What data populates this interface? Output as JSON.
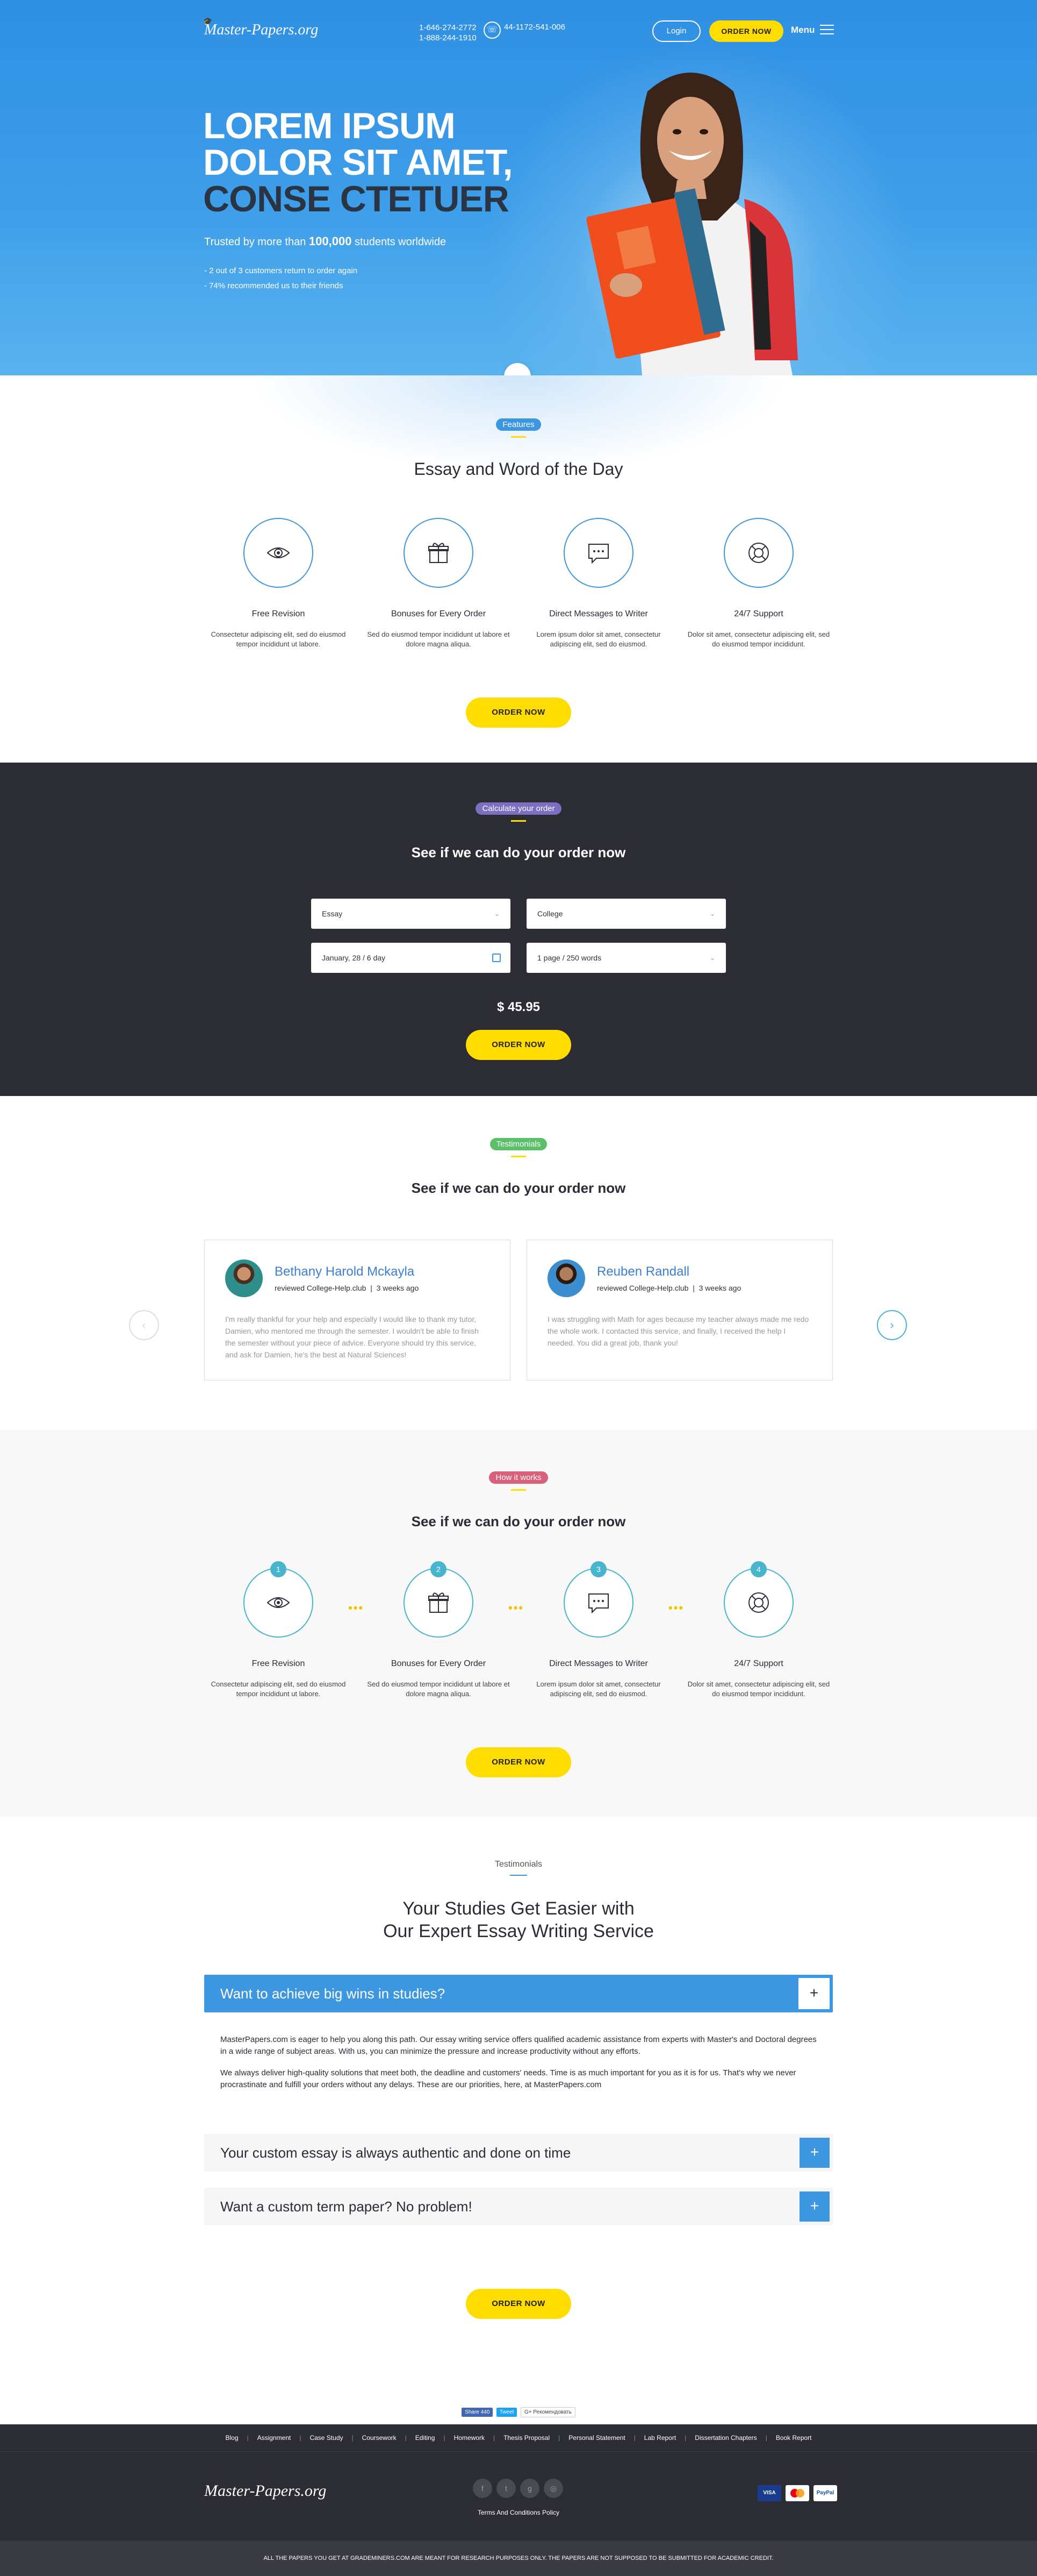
{
  "header": {
    "logo": "Master-Papers.org",
    "phone_us": "1-646-274-2772",
    "phone_us2": "1-888-244-1910",
    "phone_uk": "44-1172-541-006",
    "login": "Login",
    "order_now": "ORDER NOW",
    "menu": "Menu"
  },
  "hero": {
    "line1": "LOREM IPSUM",
    "line2": "DOLOR SIT AMET,",
    "line3": "CONSE CTETUER",
    "trust_pre": "Trusted by more than",
    "trust_num": "100,000",
    "trust_post": "students worldwide",
    "bullet1": "- 2 out of 3 customers return to order again",
    "bullet2": "- 74% recommended us to their friends"
  },
  "features": {
    "pill": "Features",
    "title": "Essay and Word of the Day",
    "items": [
      {
        "title": "Free Revision",
        "text": "Consectetur adipiscing elit, sed do eiusmod tempor incididunt ut labore.",
        "icon": "eye-icon"
      },
      {
        "title": "Bonuses for Every Order",
        "text": "Sed do eiusmod tempor incididunt ut labore et dolore magna aliqua.",
        "icon": "gift-icon"
      },
      {
        "title": "Direct Messages to Writer",
        "text": "Lorem ipsum dolor sit amet, consectetur adipiscing elit, sed do eiusmod.",
        "icon": "message-icon"
      },
      {
        "title": "24/7 Support",
        "text": "Dolor sit amet, consectetur adipiscing elit, sed do eiusmod tempor incididunt.",
        "icon": "lifebuoy-icon"
      }
    ],
    "button": "ORDER NOW"
  },
  "calculator": {
    "pill": "Calculate your order",
    "title": "See if we can do your order now",
    "type": "Essay",
    "level": "College",
    "deadline": "January, 28 / 6 day",
    "pages": "1 page / 250 words",
    "price": "$ 45.95",
    "button": "ORDER NOW"
  },
  "testimonials": {
    "pill": "Testimonials",
    "title": "See if we can do your order now",
    "reviews": [
      {
        "name": "Bethany Harold Mckayla",
        "source": "reviewed College-Help.club",
        "time": "3 weeks ago",
        "text": "I'm really thankful for your help and especially I would like to thank my tutor, Damien, who mentored me through the semester. I wouldn't be able to finish the semester without your piece of advice. Everyone should try this service, and ask for Damien, he's the best at Natural Sciences!"
      },
      {
        "name": "Reuben Randall",
        "source": "reviewed College-Help.club",
        "time": "3 weeks ago",
        "text": "I was struggling with Math for ages because my teacher always made me redo the whole work. I contacted this service, and finally, I received the help I needed. You did a great job, thank you!"
      }
    ]
  },
  "how": {
    "pill": "How it works",
    "title": "See if we can do your order now",
    "steps": [
      {
        "num": "1",
        "title": "Free Revision",
        "text": "Consectetur adipiscing elit, sed do eiusmod tempor incididunt ut labore."
      },
      {
        "num": "2",
        "title": "Bonuses for Every Order",
        "text": "Sed do eiusmod tempor incididunt ut labore et dolore magna aliqua."
      },
      {
        "num": "3",
        "title": "Direct Messages to Writer",
        "text": "Lorem ipsum dolor sit amet, consectetur adipiscing elit, sed do eiusmod."
      },
      {
        "num": "4",
        "title": "24/7 Support",
        "text": "Dolor sit amet, consectetur adipiscing elit, sed do eiusmod tempor incididunt."
      }
    ],
    "button": "ORDER NOW"
  },
  "faq": {
    "small": "Testimonials",
    "title1": "Your Studies Get Easier with",
    "title2": "Our Expert Essay Writing Service",
    "open_q": "Want to achieve big wins in studies?",
    "p1": "MasterPapers.com is eager to help you along this path. Our essay writing service offers qualified academic assistance from experts with Master's and Doctoral degrees in a wide range of subject areas. With us, you can minimize the pressure and increase productivity without any efforts.",
    "p2": "We always deliver high-quality solutions that meet both, the deadline and customers' needs. Time is as much important for you as it is for us. That's why we never procrastinate and fulfill your orders without any delays. These are our priorities, here, at MasterPapers.com",
    "q2": "Your custom essay is always authentic and done on time",
    "q3": "Want a custom term paper? No problem!",
    "button": "ORDER NOW"
  },
  "share": {
    "fb": "Share 440",
    "tw": "Tweet",
    "gp": "G+ Рекомендовать"
  },
  "footer": {
    "links": [
      "Blog",
      "Assignment",
      "Case Study",
      "Coursework",
      "Editing",
      "Homework",
      "Thesis Proposal",
      "Personal Statement",
      "Lab Report",
      "Dissertation Chapters",
      "Book Report"
    ],
    "logo": "Master-Papers.org",
    "terms": "Terms And Conditions Policy",
    "pay1": "VISA",
    "pay3": "PayPal",
    "disclaimer": "ALL THE PAPERS YOU GET AT GRADEMINERS.COM ARE MEANT FOR RESEARCH PURPOSES ONLY. THE PAPERS ARE NOT SUPPOSED TO BE SUBMITTED FOR ACADEMIC CREDIT."
  },
  "colors": {
    "primary": "#3c97e0",
    "accent": "#ffdd00",
    "dark": "#2c2c34",
    "teal": "#46b5cd"
  }
}
